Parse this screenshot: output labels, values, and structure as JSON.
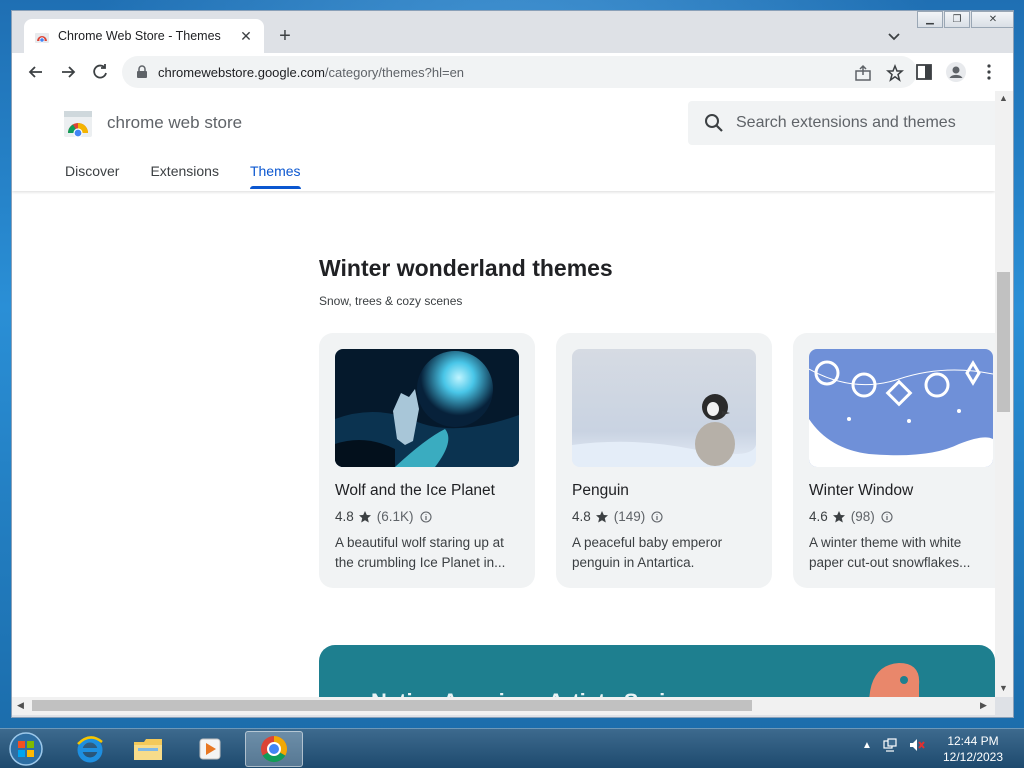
{
  "browser": {
    "tab_title": "Chrome Web Store - Themes",
    "url_host": "chromewebstore.google.com",
    "url_path": "/category/themes?hl=en"
  },
  "store": {
    "brand": "chrome web store",
    "search_placeholder": "Search extensions and themes",
    "nav": [
      {
        "label": "Discover"
      },
      {
        "label": "Extensions"
      },
      {
        "label": "Themes",
        "active": true
      }
    ]
  },
  "section": {
    "title": "Winter wonderland themes",
    "subtitle": "Snow, trees & cozy scenes"
  },
  "cards": [
    {
      "name": "Wolf and the Ice Planet",
      "rating": "4.8",
      "count": "(6.1K)",
      "desc": "A beautiful wolf staring up at the crumbling Ice Planet in..."
    },
    {
      "name": "Penguin",
      "rating": "4.8",
      "count": "(149)",
      "desc": "A peaceful baby emperor penguin in Antartica."
    },
    {
      "name": "Winter Window",
      "rating": "4.6",
      "count": "(98)",
      "desc": "A winter theme with white paper cut-out snowflakes..."
    }
  ],
  "banner": {
    "title": "Native American Artists Series"
  },
  "taskbar": {
    "time": "12:44 PM",
    "date": "12/12/2023"
  },
  "colors": {
    "accent": "#0b57d0",
    "banner": "#1e7f8f"
  }
}
